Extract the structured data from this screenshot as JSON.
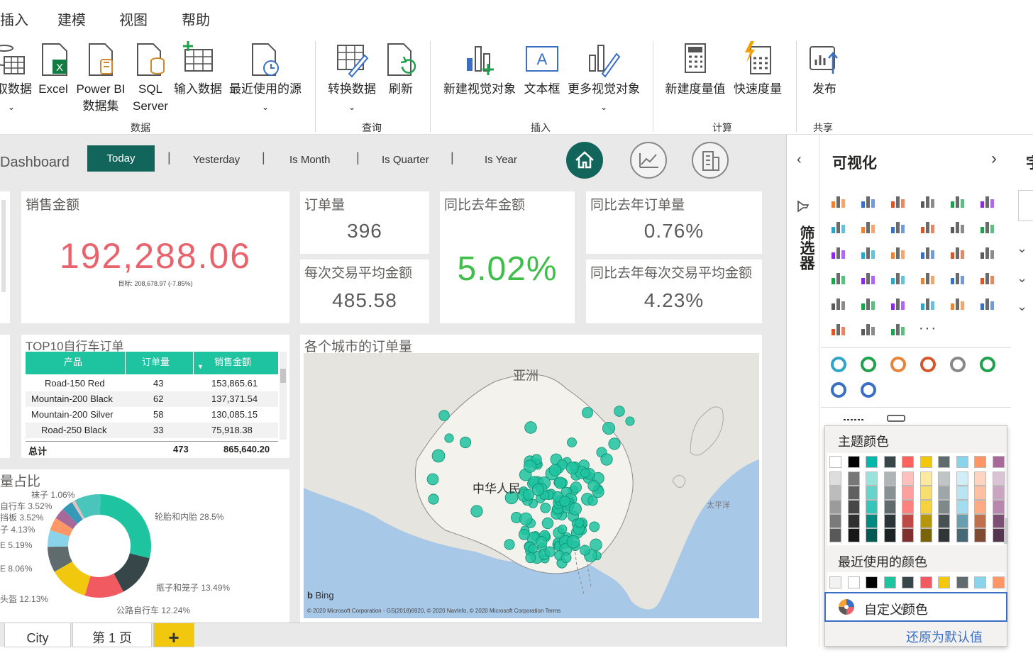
{
  "menu": [
    "插入",
    "建模",
    "视图",
    "帮助"
  ],
  "ribbon": {
    "buttons": [
      {
        "label": "获取数据"
      },
      {
        "label": "Excel"
      },
      {
        "label": "Power BI 数据集"
      },
      {
        "label": "SQL Server"
      },
      {
        "label": "输入数据"
      },
      {
        "label": "最近使用的源"
      },
      {
        "label": "转换数据"
      },
      {
        "label": "刷新"
      },
      {
        "label": "新建视觉对象"
      },
      {
        "label": "文本框"
      },
      {
        "label": "更多视觉对象"
      },
      {
        "label": "新建度量值"
      },
      {
        "label": "快速度量"
      },
      {
        "label": "发布"
      }
    ],
    "groups": [
      "数据",
      "查询",
      "插入",
      "计算",
      "共享"
    ]
  },
  "nav": {
    "title": "Dashboard",
    "buttons": [
      "Today",
      "Yesterday",
      "Is Month",
      "Is Quarter",
      "Is Year"
    ],
    "active": "Today"
  },
  "kpis": {
    "sales_title": "销售金额",
    "sales_value": "192,288.06",
    "sales_target": "目标: 208,678.97 (-7.85%)",
    "orders_title": "订单量",
    "orders_value": "396",
    "yoy_amount_title": "同比去年金额",
    "yoy_amount_value": "5.02%",
    "yoy_orders_title": "同比去年订单量",
    "yoy_orders_value": "0.76%",
    "avg_title": "每次交易平均金额",
    "avg_value": "485.58",
    "yoy_avg_title": "同比去年每次交易平均金额",
    "yoy_avg_value": "4.23%"
  },
  "top10": {
    "title": "TOP10自行车订单",
    "headers": [
      "产品",
      "订单量",
      "销售金额"
    ],
    "rows": [
      [
        "Road-150 Red",
        "43",
        "153,865.61"
      ],
      [
        "Mountain-200 Black",
        "62",
        "137,371.54"
      ],
      [
        "Mountain-200 Silver",
        "58",
        "130,085.15"
      ],
      [
        "Road-250 Black",
        "33",
        "75,918.38"
      ]
    ],
    "total": [
      "总计",
      "473",
      "865,640.20"
    ]
  },
  "donut": {
    "title": "量占比",
    "labels": [
      {
        "text": "袜子 1.06%"
      },
      {
        "text": "自行车 3.52%"
      },
      {
        "text": "挡板 3.52%"
      },
      {
        "text": "子 4.13%"
      },
      {
        "text": "E 5.19%"
      },
      {
        "text": "E 8.06%"
      },
      {
        "text": "头盔 12.13%"
      },
      {
        "text": "公路自行车 12.24%"
      },
      {
        "text": "瓶子和笼子 13.49%"
      },
      {
        "text": "轮胎和内胎 28.5%"
      }
    ],
    "slices": [
      {
        "name": "轮胎和内胎",
        "pct": 28.5,
        "color": "#1ec3a0"
      },
      {
        "name": "瓶子和笼子",
        "pct": 13.49,
        "color": "#374649"
      },
      {
        "name": "公路自行车",
        "pct": 12.24,
        "color": "#f05a60"
      },
      {
        "name": "头盔",
        "pct": 12.13,
        "color": "#f2c80f"
      },
      {
        "name": "E",
        "pct": 8.06,
        "color": "#5f6b6d"
      },
      {
        "name": "E",
        "pct": 5.19,
        "color": "#8ad4eb"
      },
      {
        "name": "子",
        "pct": 4.13,
        "color": "#fe9666"
      },
      {
        "name": "挡板",
        "pct": 3.52,
        "color": "#a66999"
      },
      {
        "name": "自行车",
        "pct": 3.52,
        "color": "#3599b8"
      },
      {
        "name": "袜子",
        "pct": 1.06,
        "color": "#dfbfbf"
      },
      {
        "name": "other",
        "pct": 8.16,
        "color": "#4ac5bb"
      }
    ]
  },
  "map": {
    "title": "各个城市的订单量",
    "labels": [
      "亚洲",
      "中华人民",
      "太平洋"
    ],
    "bing": "Bing",
    "copyright": "© 2020 Microsoft Corporation - GS(2018)6920, © 2020 NavInfo, © 2020 Microsoft Corporation  Terms"
  },
  "pages": {
    "tabs": [
      "City",
      "第 1 页"
    ],
    "add": "+"
  },
  "viz": {
    "title": "可视化",
    "filter_label": "筛选器",
    "theme_colors_title": "主题颜色",
    "recent_title": "最近使用的颜色",
    "custom_color": "自定义颜色",
    "reset": "还原为默认值",
    "theme_colors": [
      "#ffffff",
      "#000000",
      "#01b8aa",
      "#374649",
      "#fd625e",
      "#f2c80f",
      "#5f6b6d",
      "#8ad4eb",
      "#fe9666",
      "#a66999"
    ],
    "recent_colors": [
      "#f3f2f1",
      "#ffffff",
      "#000000",
      "#1ec3a0",
      "#374649",
      "#f05a60",
      "#f2c80f",
      "#5f6b6d",
      "#8ad4eb",
      "#fe9666"
    ]
  }
}
